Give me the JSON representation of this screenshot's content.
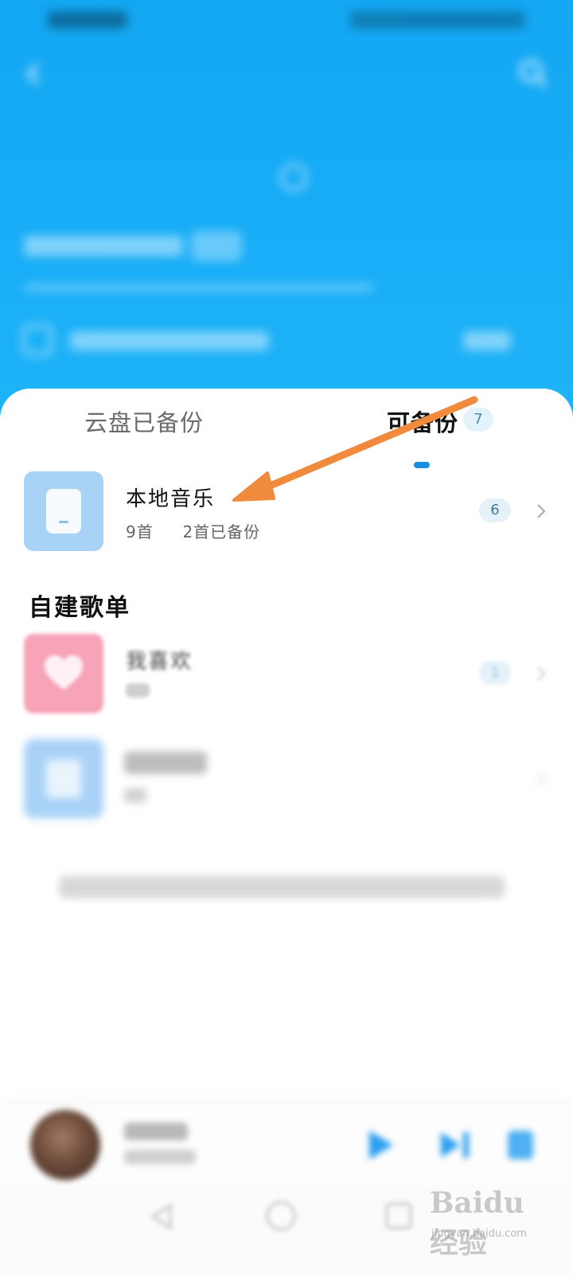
{
  "colors": {
    "header_blue": "#14a7f3",
    "accent_blue": "#1a8fe0",
    "arrow_orange": "#f08a3c",
    "badge_bg": "#e4f3fb"
  },
  "tabs": [
    {
      "label": "云盘已备份",
      "selected": false
    },
    {
      "label": "可备份",
      "selected": true,
      "badge": "7"
    }
  ],
  "local_music": {
    "title": "本地音乐",
    "song_count": "9首",
    "backed_up": "2首已备份",
    "count_badge": "6",
    "icon": "phone-device-icon"
  },
  "section_title": "自建歌单",
  "playlists": [
    {
      "title": "我喜欢",
      "count_badge": "1",
      "icon": "heart-icon"
    }
  ],
  "watermark": {
    "brand": "Baidu经验",
    "domain": "jingyan.baidu.com"
  }
}
